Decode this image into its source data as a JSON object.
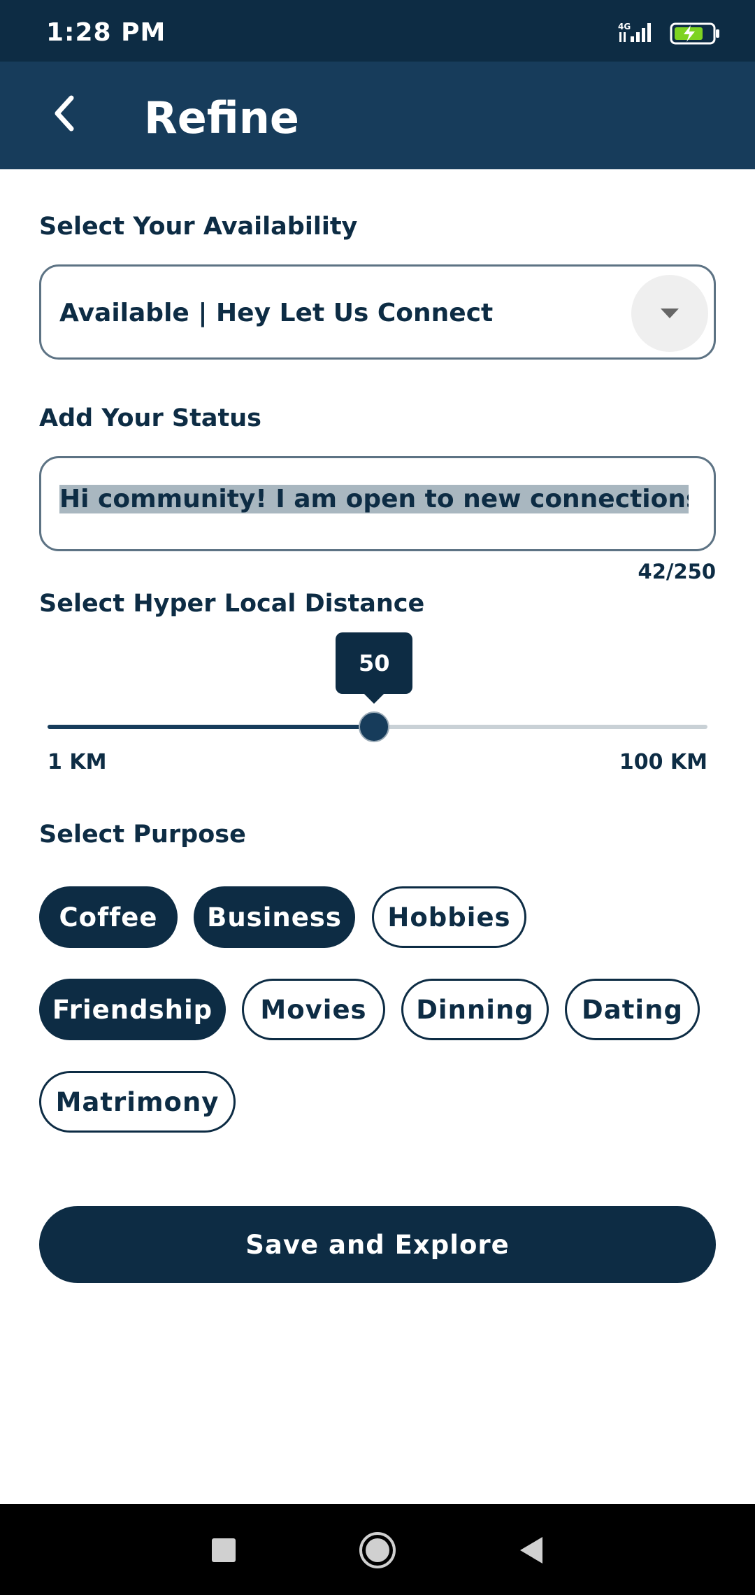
{
  "status_bar": {
    "time": "1:28 PM",
    "icons": [
      "network-4g-icon",
      "signal-icon",
      "battery-charging-icon"
    ]
  },
  "app_bar": {
    "back_icon": "chevron-left-icon",
    "title": "Refine"
  },
  "availability": {
    "label": "Select Your Availability",
    "selected_value": "Available | Hey Let Us Connect"
  },
  "status": {
    "label": "Add Your Status",
    "value": "Hi community! I am open to new connections",
    "char_count": "42/250"
  },
  "distance": {
    "label": "Select Hyper Local Distance",
    "value": "50",
    "min": 1,
    "max": 100,
    "min_label": "1 KM",
    "max_label": "100 KM"
  },
  "purpose": {
    "label": "Select Purpose",
    "chips": [
      {
        "label": "Coffee",
        "selected": true
      },
      {
        "label": "Business",
        "selected": true
      },
      {
        "label": "Hobbies",
        "selected": false
      },
      {
        "label": "Friendship",
        "selected": true
      },
      {
        "label": "Movies",
        "selected": false
      },
      {
        "label": "Dinning",
        "selected": false
      },
      {
        "label": "Dating",
        "selected": false
      },
      {
        "label": "Matrimony",
        "selected": false
      }
    ]
  },
  "save_button": {
    "label": "Save and Explore"
  },
  "colors": {
    "primary": "#0d2c44",
    "app_bar": "#173c5b",
    "selection_highlight": "#a9b7c0"
  }
}
